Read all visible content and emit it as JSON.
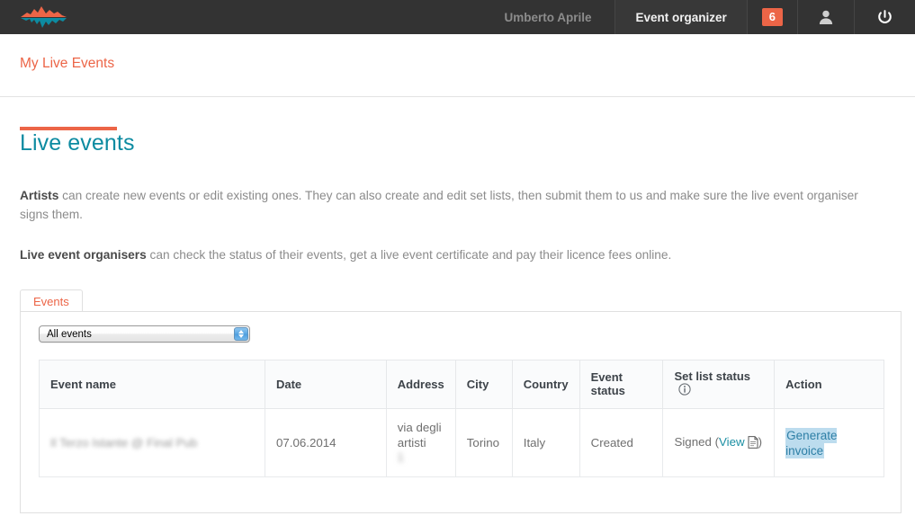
{
  "topbar": {
    "logo_name": "mountain-reflection-logo",
    "logo_colors": {
      "top": "#ec6547",
      "bottom": "#0d8ba1"
    },
    "user_name": "Umberto Aprile",
    "role_label": "Event organizer",
    "notification_count": "6",
    "account_icon": "user-icon",
    "logout_icon": "power-icon"
  },
  "nav": {
    "active_tab": "My Live Events",
    "accent_color": "#ec6547"
  },
  "main": {
    "title": "Live events",
    "title_color": "#0d8ba1",
    "paragraph1": {
      "bold": "Artists",
      "rest": " can create new events or edit existing ones. They can also create and edit set lists, then submit them to us and make sure the live event organiser signs them."
    },
    "paragraph2": {
      "bold": "Live event organisers",
      "rest": " can check the status of their events, get a live event certificate and pay their licence fees online."
    }
  },
  "panel": {
    "tab_label": "Events",
    "filter": {
      "selected": "All events",
      "options": [
        "All events"
      ]
    },
    "table": {
      "headers": [
        "Event name",
        "Date",
        "Address",
        "City",
        "Country",
        "Event status",
        "Set list status",
        "Action"
      ],
      "setlist_info_icon": "info-icon",
      "rows": [
        {
          "event_name": "Il Terzo Istante @ Final Pub",
          "event_name_redacted": true,
          "date": "07.06.2014",
          "address_line1": "via degli",
          "address_line2": "artisti",
          "address_line3": "1",
          "address_line3_redacted": true,
          "city": "Torino",
          "country": "Italy",
          "event_status": "Created",
          "set_list_status": "Signed",
          "set_list_view_label": "View",
          "set_list_open_paren": "(",
          "set_list_close_paren": ")",
          "set_list_doc_icon": "document-icon",
          "action_label": "Generate invoice",
          "action_selected": true
        }
      ]
    }
  }
}
